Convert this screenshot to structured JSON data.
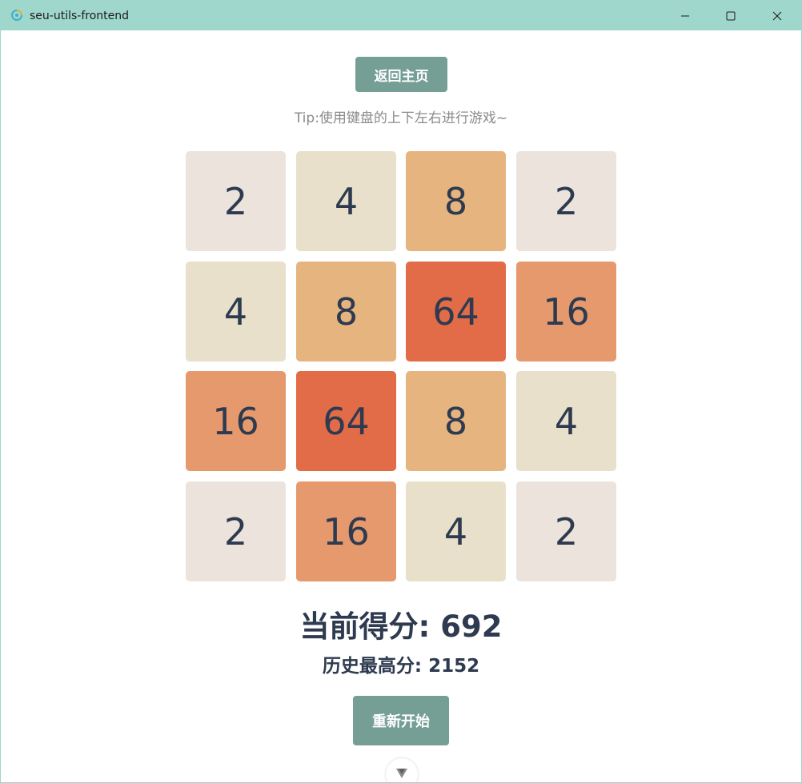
{
  "window": {
    "title": "seu-utils-frontend"
  },
  "header": {
    "home_button": "返回主页",
    "tip": "Tip:使用键盘的上下左右进行游戏~"
  },
  "board": {
    "rows": [
      [
        "2",
        "4",
        "8",
        "2"
      ],
      [
        "4",
        "8",
        "64",
        "16"
      ],
      [
        "16",
        "64",
        "8",
        "4"
      ],
      [
        "2",
        "16",
        "4",
        "2"
      ]
    ]
  },
  "tile_colors": {
    "2": "#ebe3dc",
    "4": "#e8e0ca",
    "8": "#e6b47f",
    "16": "#e6996c",
    "64": "#e26b48"
  },
  "score": {
    "current": "当前得分: 692",
    "best": "历史最高分: 2152"
  },
  "footer": {
    "restart_button": "重新开始"
  },
  "icons": {
    "app": "app-logo-icon",
    "minimize": "minimize-icon",
    "maximize": "maximize-icon",
    "close": "close-icon",
    "scroll": "chevron-down-icon"
  },
  "colors": {
    "titlebar": "#a0d7cd",
    "button": "#759e94",
    "text_dark": "#2e3a4f",
    "tip_text": "#8a8a8a"
  }
}
